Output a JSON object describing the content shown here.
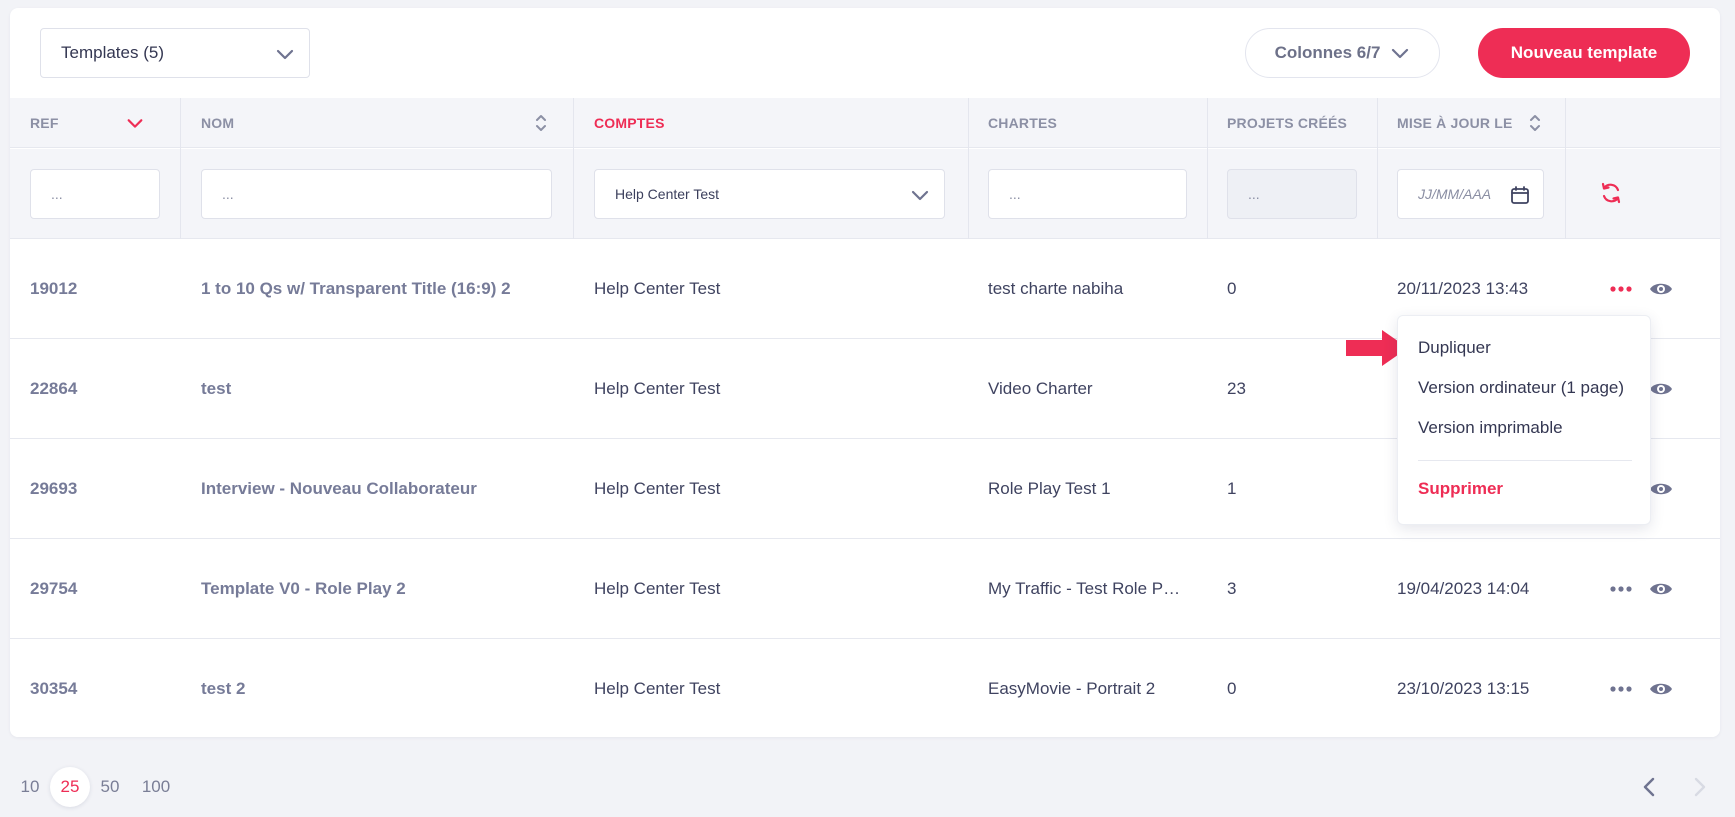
{
  "toolbar": {
    "template_select": "Templates (5)",
    "columns_button": "Colonnes 6/7",
    "new_button": "Nouveau template"
  },
  "columns": {
    "ref": "REF",
    "nom": "NOM",
    "comptes": "COMPTES",
    "chartes": "CHARTES",
    "projets": "PROJETS CRÉÉS",
    "maj": "MISE À JOUR LE"
  },
  "filters": {
    "ref_placeholder": "...",
    "nom_placeholder": "...",
    "comptes_value": "Help Center Test",
    "chartes_placeholder": "...",
    "projets_placeholder": "...",
    "date_placeholder": "JJ/MM/AAA"
  },
  "rows": [
    {
      "ref": "19012",
      "nom": "1 to 10 Qs w/ Transparent Title (16:9) 2",
      "compte": "Help Center Test",
      "charte": "test charte nabiha",
      "projets": "0",
      "date": "20/11/2023 13:43"
    },
    {
      "ref": "22864",
      "nom": "test",
      "compte": "Help Center Test",
      "charte": "Video Charter",
      "projets": "23",
      "date": ""
    },
    {
      "ref": "29693",
      "nom": "Interview - Nouveau Collaborateur",
      "compte": "Help Center Test",
      "charte": "Role Play Test 1",
      "projets": "1",
      "date": ""
    },
    {
      "ref": "29754",
      "nom": "Template V0 - Role Play 2",
      "compte": "Help Center Test",
      "charte": "My Traffic - Test Role P…",
      "projets": "3",
      "date": "19/04/2023 14:04"
    },
    {
      "ref": "30354",
      "nom": "test 2",
      "compte": "Help Center Test",
      "charte": "EasyMovie - Portrait 2",
      "projets": "0",
      "date": "23/10/2023 13:15"
    }
  ],
  "menu": {
    "dupliquer": "Dupliquer",
    "version_ordinateur": "Version ordinateur (1 page)",
    "version_imprimable": "Version imprimable",
    "supprimer": "Supprimer"
  },
  "pagination": {
    "sizes": [
      "10",
      "25",
      "50",
      "100"
    ],
    "active": "25"
  },
  "colors": {
    "accent": "#ee2d55",
    "muted": "#767b98",
    "background": "#f2f3f7"
  }
}
